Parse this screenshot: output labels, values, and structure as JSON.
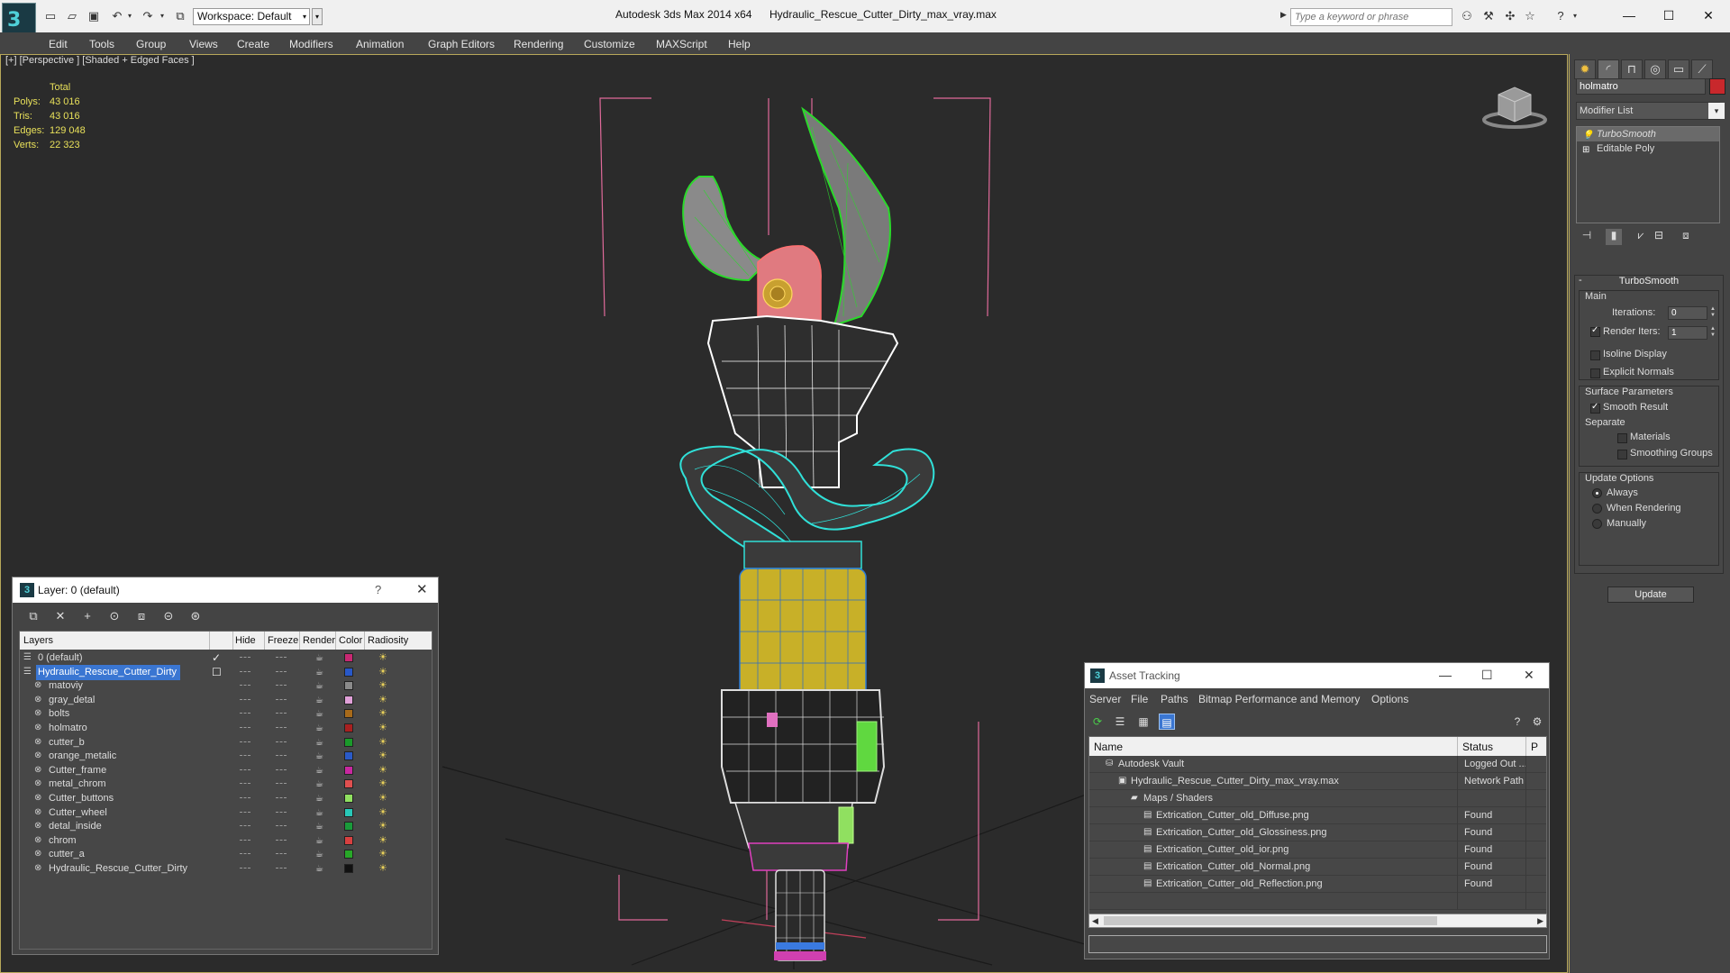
{
  "titlebar": {
    "app_title": "Autodesk 3ds Max  2014 x64",
    "file_name": "Hydraulic_Rescue_Cutter_Dirty_max_vray.max",
    "workspace_label": "Workspace: Default",
    "search_placeholder": "Type a keyword or phrase",
    "minimize": "—",
    "maximize": "☐",
    "close": "✕"
  },
  "menu": [
    "Edit",
    "Tools",
    "Group",
    "Views",
    "Create",
    "Modifiers",
    "Animation",
    "Graph Editors",
    "Rendering",
    "Customize",
    "MAXScript",
    "Help"
  ],
  "viewport": {
    "label": "[+] [Perspective ] [Shaded + Edged Faces ]",
    "stats_header": "Total",
    "stats": [
      {
        "key": "Polys:",
        "value": "43 016"
      },
      {
        "key": "Tris:",
        "value": "43 016"
      },
      {
        "key": "Edges:",
        "value": "129 048"
      },
      {
        "key": "Verts:",
        "value": "22 323"
      }
    ]
  },
  "command_panel": {
    "object_name": "holmatro",
    "object_color": "#c8282c",
    "modifier_list": "Modifier List",
    "stack": [
      {
        "label": "TurboSmooth",
        "active": true
      },
      {
        "label": "Editable Poly",
        "active": false
      }
    ],
    "turbosmooth": {
      "title": "TurboSmooth",
      "main_label": "Main",
      "iterations_label": "Iterations:",
      "iterations_value": "0",
      "render_iters_label": "Render Iters:",
      "render_iters_value": "1",
      "isoline_label": "Isoline Display",
      "explicit_label": "Explicit Normals",
      "surface_label": "Surface Parameters",
      "smooth_result_label": "Smooth Result",
      "separate_label": "Separate",
      "materials_label": "Materials",
      "smoothing_groups_label": "Smoothing Groups",
      "update_options_label": "Update Options",
      "always_label": "Always",
      "when_rendering_label": "When Rendering",
      "manually_label": "Manually",
      "update_button": "Update"
    }
  },
  "layer_panel": {
    "title": "Layer: 0 (default)",
    "help": "?",
    "close": "✕",
    "columns": [
      "Layers",
      "Hide",
      "Freeze",
      "Render",
      "Color",
      "Radiosity"
    ],
    "layers": [
      {
        "name": "0 (default)",
        "color": "#c82872",
        "level": 0,
        "selected": false,
        "current": true
      },
      {
        "name": "Hydraulic_Rescue_Cutter_Dirty",
        "color": "#2858c8",
        "level": 0,
        "selected": true,
        "current": false
      },
      {
        "name": "matoviy",
        "color": "#8a8a8a",
        "level": 1,
        "selected": false,
        "current": false
      },
      {
        "name": "gray_detal",
        "color": "#e0a0d8",
        "level": 1,
        "selected": false,
        "current": false
      },
      {
        "name": "bolts",
        "color": "#a86a1a",
        "level": 1,
        "selected": false,
        "current": false
      },
      {
        "name": "holmatro",
        "color": "#a82020",
        "level": 1,
        "selected": false,
        "current": false
      },
      {
        "name": "cutter_b",
        "color": "#1a9a2a",
        "level": 1,
        "selected": false,
        "current": false
      },
      {
        "name": "orange_metalic",
        "color": "#2a5ac8",
        "level": 1,
        "selected": false,
        "current": false
      },
      {
        "name": "Cutter_frame",
        "color": "#c828a0",
        "level": 1,
        "selected": false,
        "current": false
      },
      {
        "name": "metal_chrom",
        "color": "#e05050",
        "level": 1,
        "selected": false,
        "current": false
      },
      {
        "name": "Cutter_buttons",
        "color": "#90e060",
        "level": 1,
        "selected": false,
        "current": false
      },
      {
        "name": "Cutter_wheel",
        "color": "#28c8b8",
        "level": 1,
        "selected": false,
        "current": false
      },
      {
        "name": "detal_inside",
        "color": "#1a9a3a",
        "level": 1,
        "selected": false,
        "current": false
      },
      {
        "name": "chrom",
        "color": "#d84040",
        "level": 1,
        "selected": false,
        "current": false
      },
      {
        "name": "cutter_a",
        "color": "#28a828",
        "level": 1,
        "selected": false,
        "current": false
      },
      {
        "name": "Hydraulic_Rescue_Cutter_Dirty",
        "color": "#111111",
        "level": 1,
        "selected": false,
        "current": false
      }
    ]
  },
  "asset_panel": {
    "title": "Asset Tracking",
    "minimize": "—",
    "maximize": "☐",
    "close": "✕",
    "menu": [
      "Server",
      "File",
      "Paths",
      "Bitmap Performance and Memory",
      "Options"
    ],
    "columns": [
      "Name",
      "Status",
      "P"
    ],
    "rows": [
      {
        "name": "Autodesk Vault",
        "status": "Logged Out ...",
        "level": 0,
        "icon": "vault-icon"
      },
      {
        "name": "Hydraulic_Rescue_Cutter_Dirty_max_vray.max",
        "status": "Network Path",
        "level": 1,
        "icon": "max-file-icon"
      },
      {
        "name": "Maps / Shaders",
        "status": "",
        "level": 2,
        "icon": "maps-icon"
      },
      {
        "name": "Extrication_Cutter_old_Diffuse.png",
        "status": "Found",
        "level": 3,
        "icon": "bitmap-icon"
      },
      {
        "name": "Extrication_Cutter_old_Glossiness.png",
        "status": "Found",
        "level": 3,
        "icon": "bitmap-icon"
      },
      {
        "name": "Extrication_Cutter_old_ior.png",
        "status": "Found",
        "level": 3,
        "icon": "bitmap-icon"
      },
      {
        "name": "Extrication_Cutter_old_Normal.png",
        "status": "Found",
        "level": 3,
        "icon": "bitmap-icon"
      },
      {
        "name": "Extrication_Cutter_old_Reflection.png",
        "status": "Found",
        "level": 3,
        "icon": "bitmap-icon"
      }
    ]
  }
}
